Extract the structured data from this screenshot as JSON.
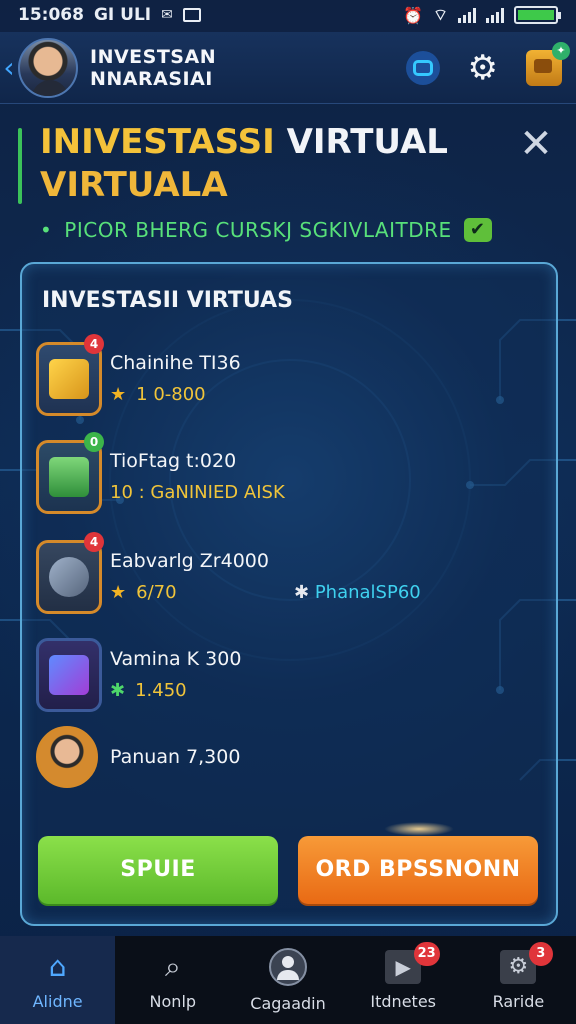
{
  "status_bar": {
    "time": "15:068",
    "left_text": "GI ULI",
    "battery_level": 1.0
  },
  "header": {
    "title_line1": "INVESTSAN",
    "title_line2": "NNARASIAI",
    "back_glyph": "‹",
    "bag_badge": "✦"
  },
  "page": {
    "title_line1_highlight": "INIVESTASSI",
    "title_line1_rest": "VIRTUAL",
    "title_line2": "VIRTUALA",
    "subtitle": "PICOR BHERG CURSKJ SGKIVLAITDRE",
    "close_glyph": "✕",
    "check_glyph": "✔"
  },
  "panel": {
    "title": "INVESTASII VIRTUAS",
    "items": [
      {
        "name": "Chainihe TI36",
        "value": "1 0-800",
        "badge": "4",
        "badge_color": "#e0353a",
        "icon": "gold-bars-icon",
        "star": "★"
      },
      {
        "name": "TioFtag t:020",
        "value": "10 : GaNINIED AISK",
        "badge": "0",
        "badge_color": "#3cb54a",
        "icon": "cash-stack-icon",
        "star": ""
      },
      {
        "name": "Eabvarlg Zr4000",
        "value": "6/70",
        "extra": "PhanalSP60",
        "extra_glyph": "✱",
        "badge": "4",
        "badge_color": "#e0353a",
        "icon": "coin-vault-icon",
        "star": "★"
      },
      {
        "name": "Vamina K 300",
        "value": "1.450",
        "badge": "",
        "icon": "crypto-cube-icon",
        "star": "✱"
      },
      {
        "name": "Panuan 7,300",
        "value": "",
        "badge": "",
        "icon": "person-avatar-icon",
        "star": ""
      }
    ],
    "btn_primary": "SPUIE",
    "btn_secondary": "ORD BPSSNONN"
  },
  "bottom_nav": [
    {
      "label": "Alidne",
      "icon": "home-icon",
      "glyph": "⌂",
      "badge": ""
    },
    {
      "label": "Nonlp",
      "icon": "search-icon",
      "glyph": "⌕",
      "badge": ""
    },
    {
      "label": "Cagaadin",
      "icon": "profile-icon",
      "glyph": "",
      "badge": ""
    },
    {
      "label": "Itdnetes",
      "icon": "play-box-icon",
      "glyph": "▶",
      "badge": "23"
    },
    {
      "label": "Raride",
      "icon": "settings-box-icon",
      "glyph": "⚙",
      "badge": "3"
    }
  ],
  "colors": {
    "accent_gold": "#f4c23a",
    "accent_green": "#58e07a",
    "panel_border": "#5aa8d6",
    "btn_green": "#6cc83a",
    "btn_orange": "#ee7a1e"
  }
}
